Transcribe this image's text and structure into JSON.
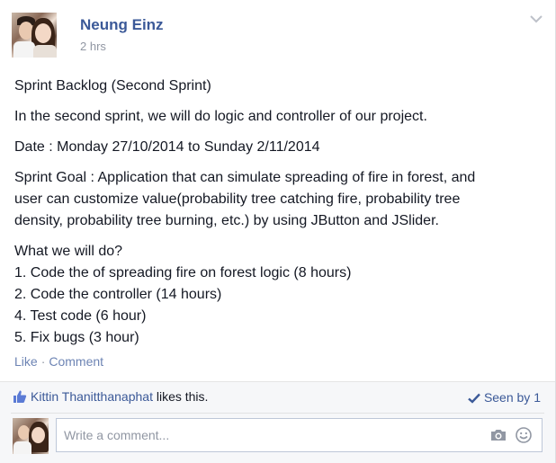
{
  "post": {
    "author": "Neung Einz",
    "timestamp": "2 hrs",
    "paragraphs": [
      [
        "Sprint Backlog (Second Sprint)"
      ],
      [
        "In the second sprint, we will do logic and controller of our project."
      ],
      [
        "Date : Monday 27/10/2014 to Sunday 2/11/2014"
      ],
      [
        "Sprint Goal : Application that can simulate spreading of fire in forest, and",
        "user can customize value(probability tree catching fire, probability tree",
        "density, probability tree burning, etc.) by using JButton and JSlider."
      ],
      [
        "What we will do?",
        "1. Code the of spreading fire on forest logic (8 hours)",
        "2. Code the controller (14 hours)",
        "4. Test code (6 hour)",
        "5. Fix bugs (3 hour)"
      ]
    ]
  },
  "actions": {
    "like": "Like",
    "separator": "·",
    "comment": "Comment"
  },
  "footer": {
    "liker": "Kittin Thanitthanaphat",
    "likes_suffix": " likes this.",
    "seen": "Seen by 1"
  },
  "comment_box": {
    "placeholder": "Write a comment..."
  },
  "icons": {
    "menu": "chevron-down-icon",
    "like": "thumbs-up-icon",
    "seen": "checkmark-icon",
    "photo": "camera-icon",
    "emoji": "smiley-icon"
  },
  "colors": {
    "link": "#3b5998",
    "muted": "#9197a3",
    "text": "#141823",
    "footer_bg": "#f6f7f9"
  }
}
